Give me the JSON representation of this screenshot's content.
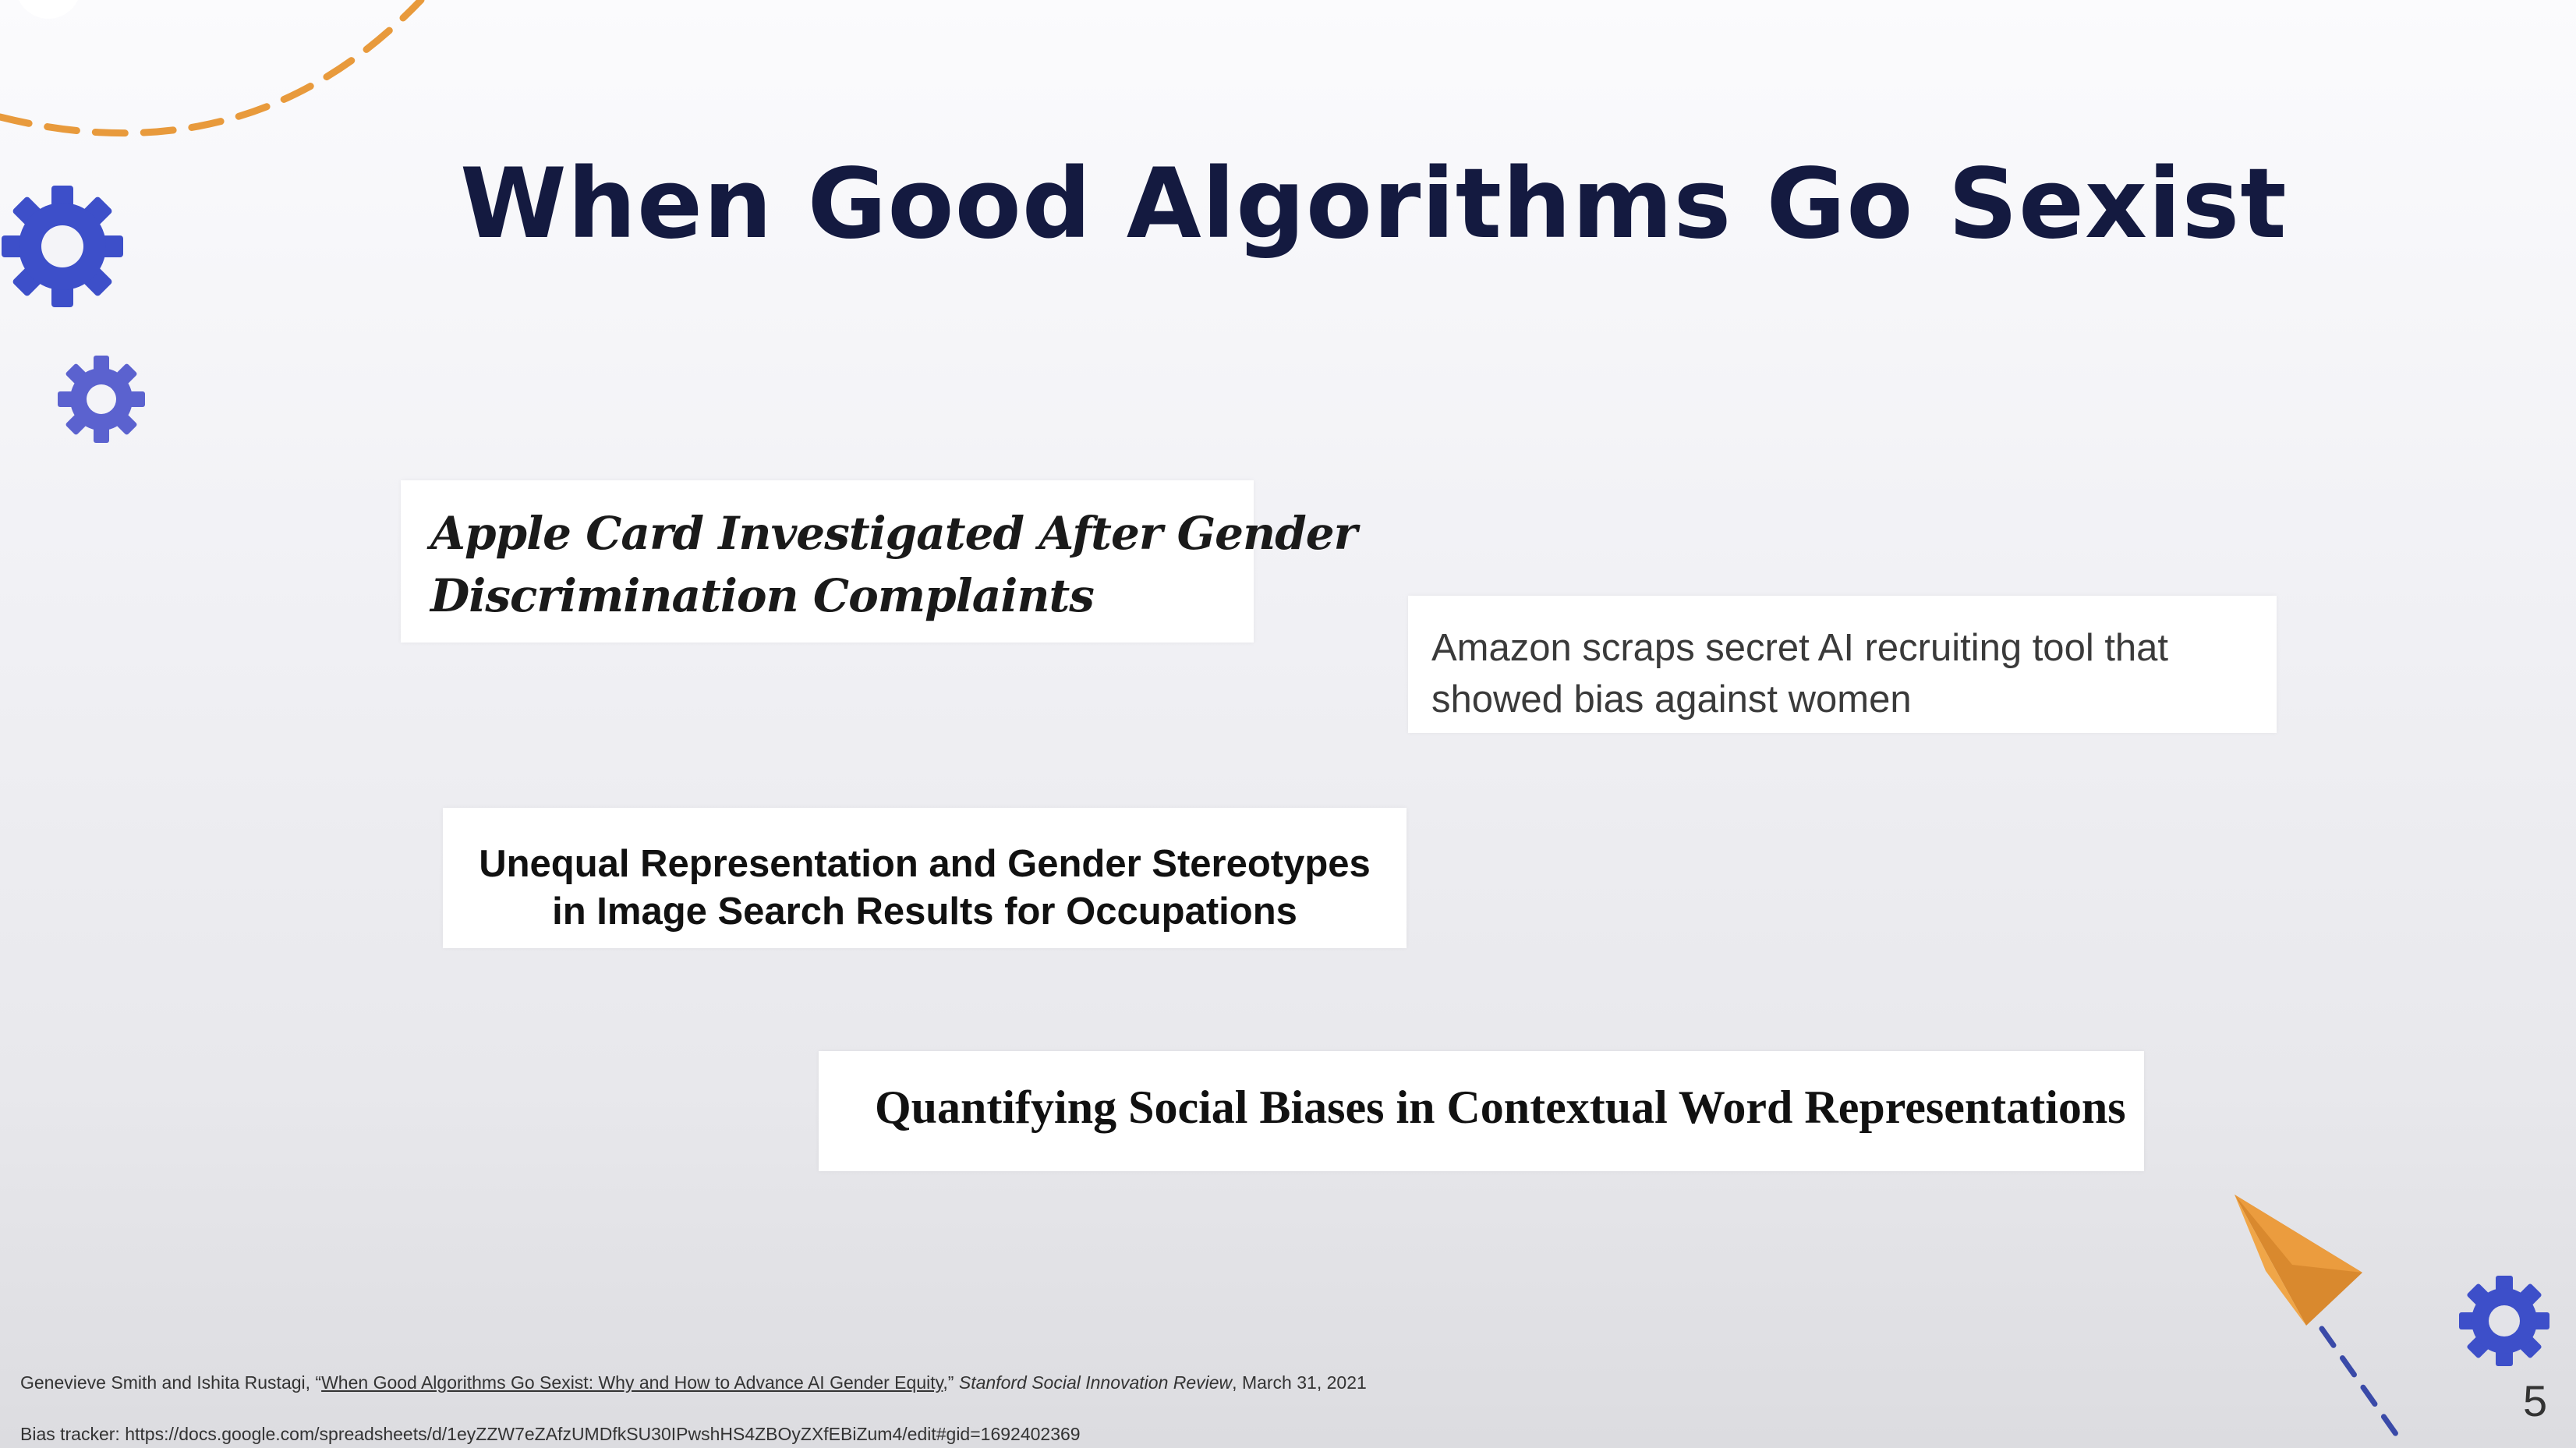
{
  "slide": {
    "title": "When Good Algorithms Go Sexist",
    "page_number": "5"
  },
  "headlines": {
    "apple_line1": "Apple Card Investigated After Gender",
    "apple_line2": "Discrimination Complaints",
    "amazon_line1": "Amazon scraps secret AI recruiting tool that",
    "amazon_line2": "showed bias against women",
    "unequal_line1": "Unequal Representation and Gender Stereotypes",
    "unequal_line2": "in Image Search Results for Occupations",
    "quantifying": "Quantifying Social Biases in Contextual Word Representations"
  },
  "footer": {
    "authors": "Genevieve Smith and Ishita Rustagi, “",
    "article_link": "When Good Algorithms Go Sexist: Why and How to Advance AI Gender Equity",
    "after_link": ",” ",
    "publication": "Stanford Social Innovation Review",
    "date": ", March 31, 2021",
    "tracker_label": "Bias tracker: ",
    "tracker_url": "https://docs.google.com/spreadsheets/d/1eyZZW7eZAfzUMDfkSU30IPwshHS4ZBOyZXfEBiZum4/edit#gid=1692402369"
  },
  "colors": {
    "title": "#141a40",
    "gear": "#3d4fc9",
    "orange_accent": "#e89a3c",
    "navy_dash": "#3a4aa8"
  },
  "icons": [
    "gear-icon",
    "paper-plane-icon"
  ]
}
